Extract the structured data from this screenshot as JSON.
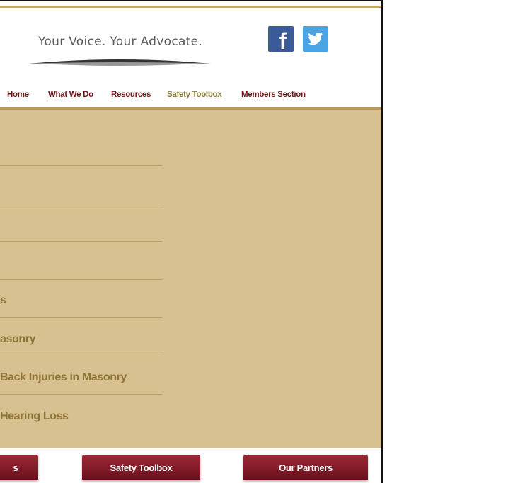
{
  "header": {
    "tagline": "Your Voice. Your Advocate.",
    "social": [
      {
        "name": "facebook-icon",
        "glyph": "f",
        "color": "#3b5a9a"
      },
      {
        "name": "twitter-icon",
        "color": "#4aa4e3"
      }
    ]
  },
  "nav": {
    "items": [
      {
        "label": "Home"
      },
      {
        "label": "What We Do"
      },
      {
        "label": "Resources"
      },
      {
        "label": "Safety Toolbox",
        "active": true
      },
      {
        "label": "Members Section"
      }
    ]
  },
  "main": {
    "list": [
      {
        "label": ""
      },
      {
        "label": ""
      },
      {
        "label": ""
      },
      {
        "label": ""
      },
      {
        "label": "s"
      },
      {
        "label": "asonry"
      },
      {
        "label": "Back Injuries in Masonry"
      },
      {
        "label": "Hearing Loss"
      }
    ]
  },
  "footer": {
    "buttons": [
      {
        "label": "s"
      },
      {
        "label": "Safety Toolbox"
      },
      {
        "label": "Our Partners"
      }
    ]
  },
  "colors": {
    "nav_text": "#6e1516",
    "nav_active": "#8a7a3a",
    "content_bg": "#d8c190",
    "list_text": "#8d7336",
    "button_bg": "#7a1522"
  }
}
